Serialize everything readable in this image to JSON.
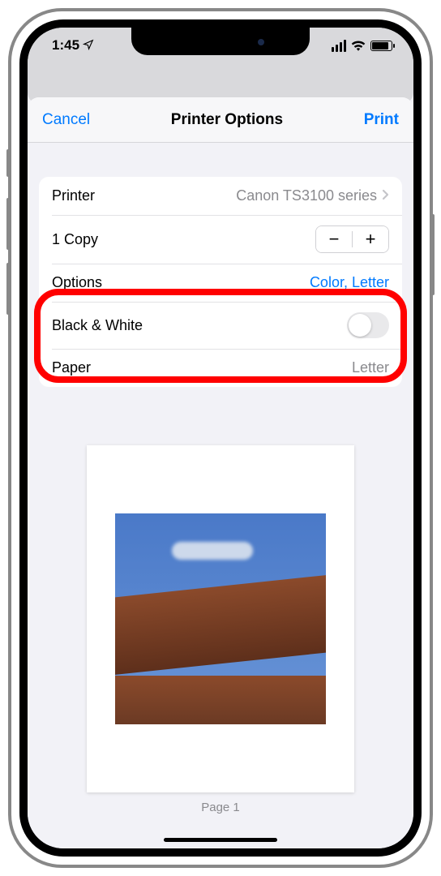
{
  "status": {
    "time": "1:45",
    "location_glyph": "➤"
  },
  "nav": {
    "cancel": "Cancel",
    "title": "Printer Options",
    "print": "Print"
  },
  "rows": {
    "printer_label": "Printer",
    "printer_value": "Canon TS3100 series",
    "copies_label": "1 Copy",
    "options_label": "Options",
    "options_value": "Color, Letter",
    "bw_label": "Black & White",
    "bw_on": false,
    "paper_label": "Paper",
    "paper_value": "Letter"
  },
  "preview": {
    "page_label": "Page 1"
  }
}
